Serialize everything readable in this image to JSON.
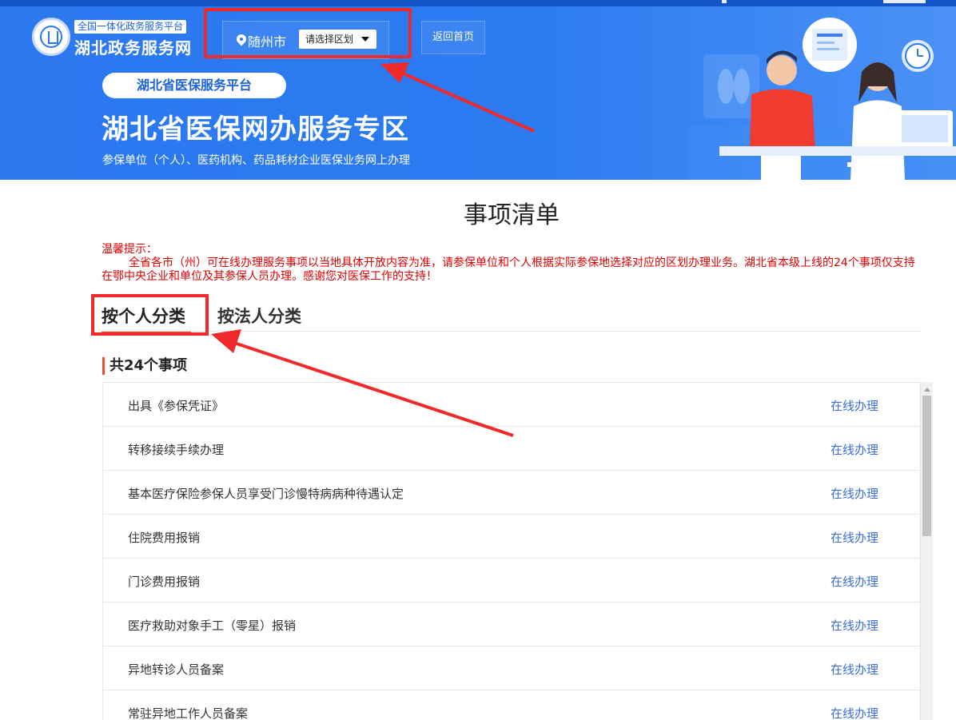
{
  "header": {
    "site_subtitle": "全国一体化政务服务平台",
    "site_title": "湖北政务服务网",
    "city": "随州市",
    "district_select": "请选择区划",
    "home_button": "返回首页"
  },
  "banner": {
    "platform_pill": "湖北省医保服务平台",
    "title": "湖北省医保网办服务专区",
    "subtitle": "参保单位（个人）、医药机构、药品耗材企业医保业务网上办理"
  },
  "main": {
    "title": "事项清单",
    "notice_label": "温馨提示：",
    "notice_body": "全省各市（州）可在线办理服务事项以当地具体开放内容为准，请参保单位和个人根据实际参保地选择对应的区划办理业务。湖北省本级上线的24个事项仅支持在鄂中央企业和单位及其参保人员办理。感谢您对医保工作的支持！",
    "tabs": [
      {
        "label": "按个人分类",
        "active": true
      },
      {
        "label": "按法人分类",
        "active": false
      }
    ],
    "count_label": "共24个事项",
    "items": [
      {
        "name": "出具《参保凭证》",
        "action": "在线办理"
      },
      {
        "name": "转移接续手续办理",
        "action": "在线办理"
      },
      {
        "name": "基本医疗保险参保人员享受门诊慢特病病种待遇认定",
        "action": "在线办理"
      },
      {
        "name": "住院费用报销",
        "action": "在线办理"
      },
      {
        "name": "门诊费用报销",
        "action": "在线办理"
      },
      {
        "name": "医疗救助对象手工（零星）报销",
        "action": "在线办理"
      },
      {
        "name": "异地转诊人员备案",
        "action": "在线办理"
      },
      {
        "name": "常驻异地工作人员备案",
        "action": "在线办理"
      }
    ]
  },
  "colors": {
    "banner_blue": "#2b78ef",
    "annotation_red": "#f02a2a",
    "notice_red": "#e00000",
    "link_blue": "#3a6fd8",
    "tab_underline": "#e94f2b"
  },
  "icons": [
    "location-pin-icon",
    "dropdown-caret-icon",
    "logo-emblem-icon",
    "clock-icon"
  ]
}
